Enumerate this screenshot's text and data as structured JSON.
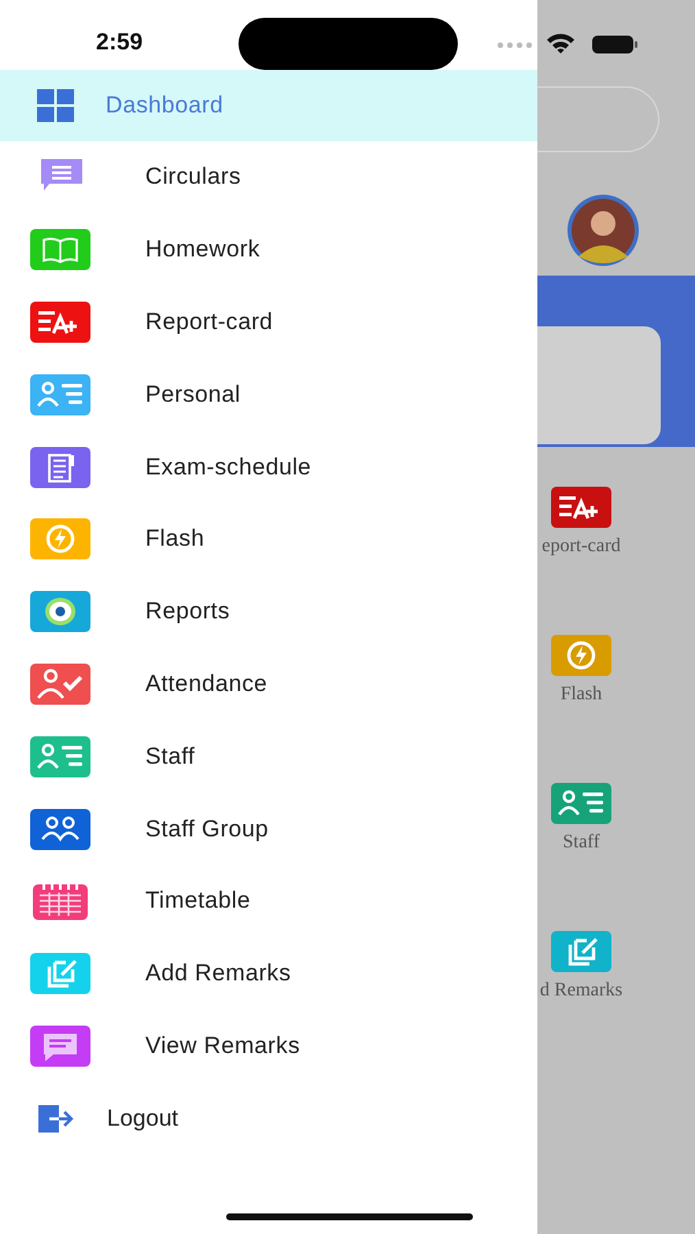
{
  "status_bar": {
    "time": "2:59"
  },
  "drawer": {
    "items": [
      {
        "label": "Dashboard",
        "kind": "grid",
        "color": "#3b6fd8",
        "selected": true
      },
      {
        "label": "Circulars",
        "kind": "bubble",
        "color": "#a58bf5",
        "selected": false
      },
      {
        "label": "Homework",
        "kind": "book",
        "color": "#22cc1a",
        "selected": false
      },
      {
        "label": "Report-card",
        "kind": "grade",
        "color": "#ee1111",
        "selected": false
      },
      {
        "label": "Personal",
        "kind": "profile",
        "color": "#3bb3f5",
        "selected": false
      },
      {
        "label": "Exam-schedule",
        "kind": "exam",
        "color": "#7a63ef",
        "selected": false
      },
      {
        "label": "Flash",
        "kind": "flash",
        "color": "#fdb400",
        "selected": false
      },
      {
        "label": "Reports",
        "kind": "eye",
        "color": "#16a8d8",
        "selected": false
      },
      {
        "label": "Attendance",
        "kind": "attendance",
        "color": "#ef4f4f",
        "selected": false
      },
      {
        "label": "Staff",
        "kind": "profile",
        "color": "#1dbf8c",
        "selected": false
      },
      {
        "label": "Staff Group",
        "kind": "group",
        "color": "#0f63d6",
        "selected": false
      },
      {
        "label": "Timetable",
        "kind": "calendar",
        "color": "#f33c7c",
        "selected": false
      },
      {
        "label": "Add Remarks",
        "kind": "edit",
        "color": "#14d2ec",
        "selected": false
      },
      {
        "label": "View Remarks",
        "kind": "message",
        "color": "#c53cf5",
        "selected": false
      }
    ],
    "logout": {
      "label": "Logout"
    }
  },
  "dashboard_behind": {
    "tiles": [
      {
        "label": "eport-card",
        "kind": "grade",
        "color": "#c81010"
      },
      {
        "label": "Flash",
        "kind": "flash",
        "color": "#d89c00"
      },
      {
        "label": "Staff",
        "kind": "profile",
        "color": "#16a37a"
      },
      {
        "label": "d Remarks",
        "kind": "edit",
        "color": "#10b3c9"
      }
    ]
  }
}
